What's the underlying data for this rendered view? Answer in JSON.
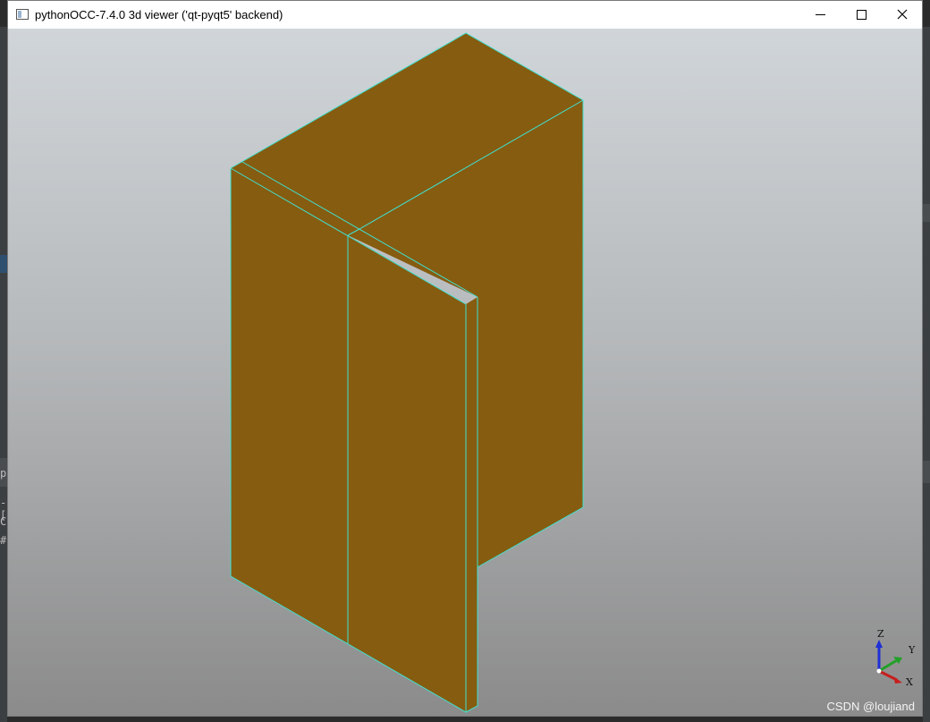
{
  "window": {
    "title": "pythonOCC-7.4.0 3d viewer ('qt-pyqt5' backend)",
    "icon": "app-window-icon",
    "controls": [
      "minimize-icon",
      "maximize-icon",
      "close-icon"
    ]
  },
  "viewer": {
    "shape_fill_color": "#865c10",
    "edge_color": "#40e0d0",
    "triedron": {
      "z_label": "Z",
      "y_label": "Y",
      "x_label": "X",
      "z_color": "#1f2fd6",
      "y_color": "#22a028",
      "x_color": "#c81e1e"
    },
    "watermark": "CSDN @loujiand"
  },
  "background_glyphs": [
    "p",
    "-[",
    "C",
    "#"
  ]
}
